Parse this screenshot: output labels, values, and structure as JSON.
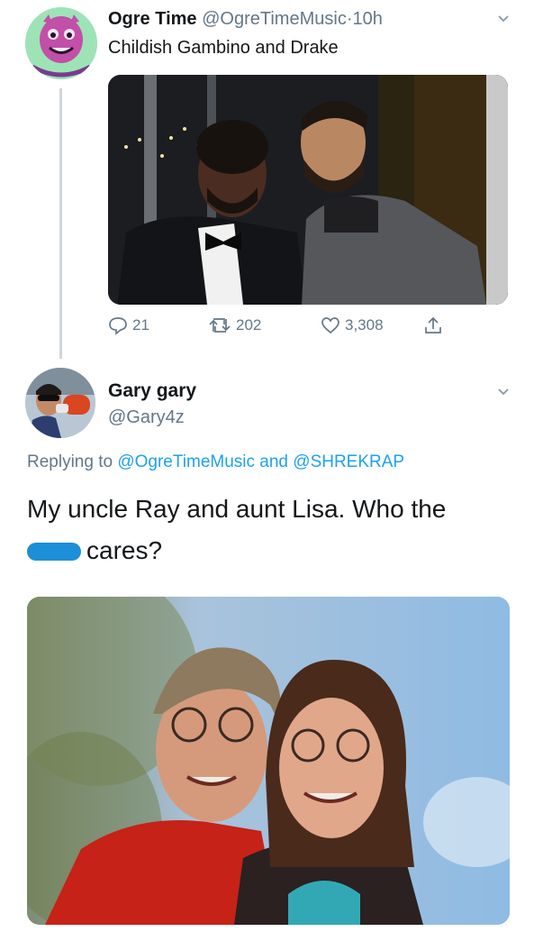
{
  "tweet1": {
    "display_name": "Ogre Time",
    "handle": "@OgreTimeMusic",
    "separator": "·",
    "time": "10h",
    "text": "Childish Gambino and Drake",
    "replies": "21",
    "retweets": "202",
    "likes": "3,308"
  },
  "tweet2": {
    "display_name": "Gary gary",
    "handle": "@Gary4z",
    "replying_prefix": "Replying to",
    "mention1": "@OgreTimeMusic",
    "replying_and": "and",
    "mention2": "@SHREKRAP",
    "text_line1": "My uncle Ray and aunt Lisa. Who the",
    "text_line2": "cares?"
  },
  "colors": {
    "link": "#1da1f2",
    "secondary_text": "#657786",
    "thread_line": "#cfd6dc",
    "censor_blob": "#1d8ed8"
  }
}
